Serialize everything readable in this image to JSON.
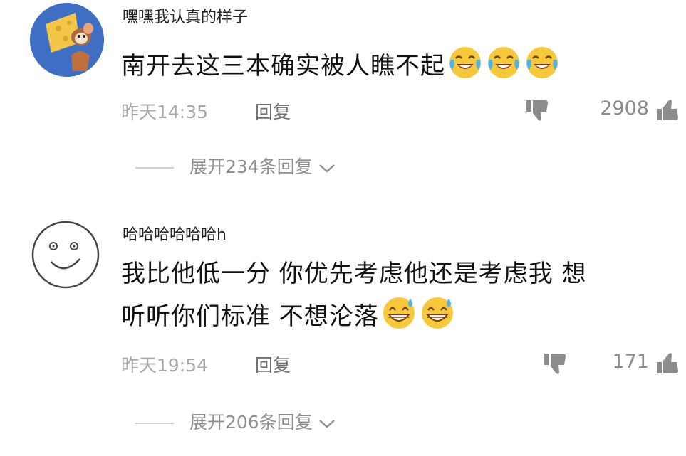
{
  "comments": [
    {
      "username": "嘿嘿我认真的样子",
      "text": "南开去这三本确实被人瞧不起",
      "emojis": [
        "laugh-cry-emoji",
        "laugh-cry-emoji",
        "laugh-cry-emoji"
      ],
      "time": "昨天14:35",
      "reply_label": "回复",
      "like_count": "2908",
      "expand_label": "展开234条回复"
    },
    {
      "username": "哈哈哈哈哈哈h",
      "text_line1": "我比他低一分 你优先考虑他还是考虑我 想",
      "text_line2": "听听你们标准 不想沦落",
      "emojis": [
        "sweat-grin-emoji",
        "sweat-grin-emoji"
      ],
      "time": "昨天19:54",
      "reply_label": "回复",
      "like_count": "171",
      "expand_label": "展开206条回复"
    }
  ],
  "colors": {
    "avatar1_bg": "#3f6fc4",
    "emoji_yellow": "#f7c83a",
    "meta_gray": "#a8a8a8"
  }
}
